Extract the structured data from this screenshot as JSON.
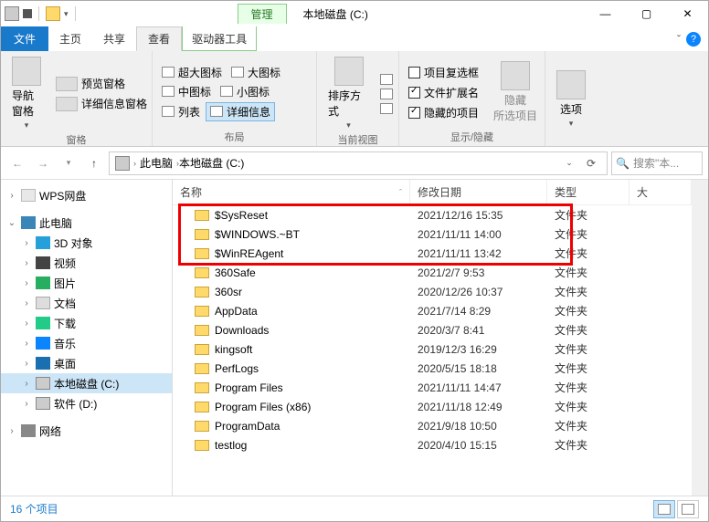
{
  "titlebar": {
    "manage": "管理",
    "title": "本地磁盘 (C:)"
  },
  "menubar": {
    "file": "文件",
    "home": "主页",
    "share": "共享",
    "view": "查看",
    "drive_tools": "驱动器工具"
  },
  "ribbon": {
    "nav_pane": "导航窗格",
    "preview_pane": "预览窗格",
    "details_pane": "详细信息窗格",
    "panes_label": "窗格",
    "xl_icons": "超大图标",
    "lg_icons": "大图标",
    "md_icons": "中图标",
    "sm_icons": "小图标",
    "list": "列表",
    "details": "详细信息",
    "layout_label": "布局",
    "sort": "排序方式",
    "current_view_label": "当前视图",
    "item_checkboxes": "项目复选框",
    "file_ext": "文件扩展名",
    "hidden_items": "隐藏的项目",
    "hide_selected": "隐藏\n所选项目",
    "showhide_label": "显示/隐藏",
    "options": "选项"
  },
  "address": {
    "this_pc": "此电脑",
    "drive": "本地磁盘 (C:)",
    "search_placeholder": "搜索\"本..."
  },
  "tree": {
    "wps": "WPS网盘",
    "this_pc": "此电脑",
    "threed": "3D 对象",
    "videos": "视频",
    "pictures": "图片",
    "documents": "文档",
    "downloads": "下载",
    "music": "音乐",
    "desktop": "桌面",
    "drive_c": "本地磁盘 (C:)",
    "drive_d": "软件 (D:)",
    "network": "网络"
  },
  "columns": {
    "name": "名称",
    "date": "修改日期",
    "type": "类型",
    "size": "大"
  },
  "files": [
    {
      "name": "$SysReset",
      "date": "2021/12/16 15:35",
      "type": "文件夹"
    },
    {
      "name": "$WINDOWS.~BT",
      "date": "2021/11/11 14:00",
      "type": "文件夹"
    },
    {
      "name": "$WinREAgent",
      "date": "2021/11/11 13:42",
      "type": "文件夹"
    },
    {
      "name": "360Safe",
      "date": "2021/2/7 9:53",
      "type": "文件夹"
    },
    {
      "name": "360sr",
      "date": "2020/12/26 10:37",
      "type": "文件夹"
    },
    {
      "name": "AppData",
      "date": "2021/7/14 8:29",
      "type": "文件夹"
    },
    {
      "name": "Downloads",
      "date": "2020/3/7 8:41",
      "type": "文件夹"
    },
    {
      "name": "kingsoft",
      "date": "2019/12/3 16:29",
      "type": "文件夹"
    },
    {
      "name": "PerfLogs",
      "date": "2020/5/15 18:18",
      "type": "文件夹"
    },
    {
      "name": "Program Files",
      "date": "2021/11/11 14:47",
      "type": "文件夹"
    },
    {
      "name": "Program Files (x86)",
      "date": "2021/11/18 12:49",
      "type": "文件夹"
    },
    {
      "name": "ProgramData",
      "date": "2021/9/18 10:50",
      "type": "文件夹"
    },
    {
      "name": "testlog",
      "date": "2020/4/10 15:15",
      "type": "文件夹"
    }
  ],
  "status": {
    "count": "16 个项目"
  }
}
